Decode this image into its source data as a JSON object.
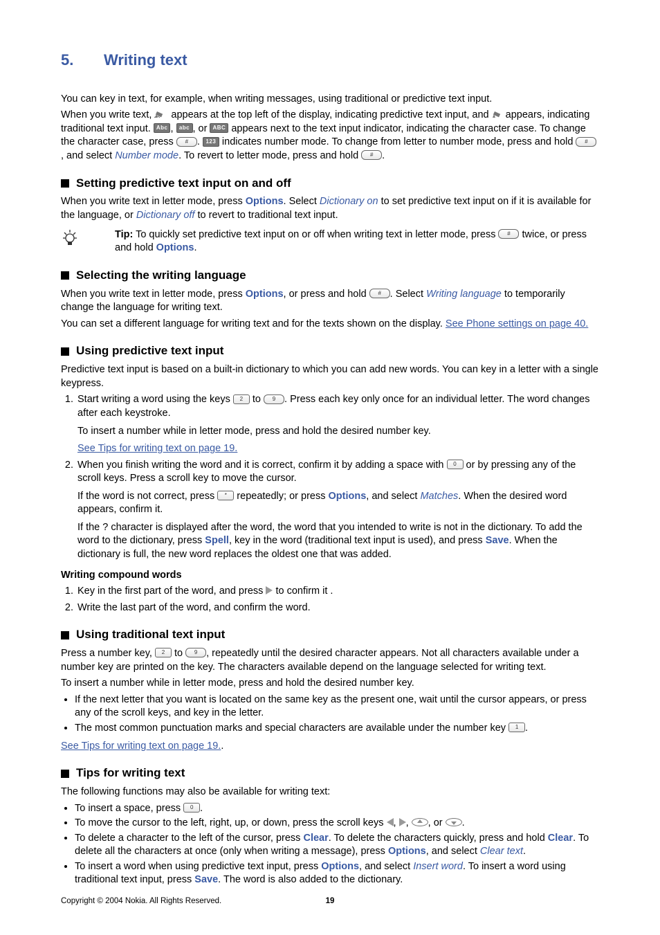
{
  "chapter": {
    "num": "5.",
    "title": "Writing text"
  },
  "intro": {
    "p1": "You can key in text, for example, when writing messages, using traditional or predictive text input.",
    "p2a": "When you write text, ",
    "p2b": " appears at the top left of the display, indicating predictive text input, and ",
    "p2c": " appears, indicating traditional text input. ",
    "p2d": ", ",
    "p2e": ", or",
    "p2f": " appears next to the text input indicator, indicating the character case. To change the character case, press ",
    "p2g": ". ",
    "p2h": " indicates number mode. To change from letter to number mode, press and hold ",
    "p2i": ", and select ",
    "number_mode": "Number mode",
    "p2j": ". To revert to letter mode, press and hold ",
    "p2k": "."
  },
  "ind": {
    "Abc": "Abc",
    "abc": "abc",
    "ABC": "ABC",
    "num": "123",
    "hash": "#",
    "star": "*",
    "two": "2",
    "nine": "9",
    "zero": "0",
    "one": "1"
  },
  "s1": {
    "heading": "Setting predictive text input on and off",
    "p1a": "When you write text in letter mode, press ",
    "options": "Options",
    "p1b": ". Select ",
    "dict_on": "Dictionary on",
    "p1c": " to set predictive text input on if it is available for the language, or ",
    "dict_off": "Dictionary off",
    "p1d": " to revert to traditional text input.",
    "tip_label": "Tip:",
    "tip_a": " To quickly set predictive text input on or off when writing text in letter mode, press ",
    "tip_b": " twice, or press and hold ",
    "tip_c": "."
  },
  "s2": {
    "heading": "Selecting the writing language",
    "p1a": "When you write text in letter mode, press ",
    "p1b": ", or press and hold ",
    "p1c": ". Select ",
    "writing_lang": "Writing language",
    "p1d": " to temporarily change the language for writing text.",
    "p2a": "You can set a different language for writing text and for the texts shown on the display. ",
    "link": "See Phone settings on page 40."
  },
  "s3": {
    "heading": "Using predictive text input",
    "p1": "Predictive text input is based on a built-in dictionary to which you can add new words. You can key in a letter with a single keypress.",
    "li1a": "Start writing a word using the keys ",
    "li1b": " to ",
    "li1c": ". Press each key only once for an individual letter. The word changes after each keystroke.",
    "li1_sub1": "To insert a number while in letter mode, press and hold the desired number key.",
    "li1_link": "See Tips for writing text on page 19.",
    "li2a": "When you finish writing the word and it is correct, confirm it by adding a space with ",
    "li2b": " or by pressing any of the scroll keys. Press a scroll key to move the cursor.",
    "li2_sub1a": "If the word is not correct, press ",
    "li2_sub1b": " repeatedly; or press ",
    "li2_sub1c": ", and select ",
    "matches": "Matches",
    "li2_sub1d": ". When the desired word appears, confirm it.",
    "li2_sub2a": "If the ? character is displayed after the word, the word that you intended to write is not in the dictionary. To add the word to the dictionary, press ",
    "spell": "Spell",
    "li2_sub2b": ", key in the word (traditional text input is used), and press ",
    "save": "Save",
    "li2_sub2c": ". When the dictionary is full, the new word replaces the oldest one that was added.",
    "compound_head": "Writing compound words",
    "c1a": "Key in the first part of the word, and press ",
    "c1b": " to confirm it .",
    "c2": "Write the last part of the word, and confirm the word."
  },
  "s4": {
    "heading": "Using traditional text input",
    "p1a": "Press a number key, ",
    "p1b": " to ",
    "p1c": ", repeatedly until the desired character appears. Not all characters available under a number key are printed on the key. The characters available depend on the language selected for writing text.",
    "p2": "To insert a number while in letter mode, press and hold the desired number key.",
    "b1": "If the next letter that you want is located on the same key as the present one, wait until the cursor appears, or press any of the scroll keys, and key in the letter.",
    "b2a": "The most common punctuation marks and special characters are available under the number key ",
    "b2b": ".",
    "link": "See Tips for writing text on page 19.",
    "linkdot": "."
  },
  "s5": {
    "heading": "Tips for writing text",
    "p1": "The following functions may also be available for writing text:",
    "b1a": "To insert a space, press ",
    "b1b": ".",
    "b2a": "To move the cursor to the left, right, up, or down, press the scroll keys ",
    "b2b": ", ",
    "b2c": ", ",
    "b2d": ", or ",
    "b2e": ".",
    "b3a": "To delete a character to the left of the cursor, press ",
    "clear": "Clear",
    "b3b": ". To delete the characters quickly, press and hold ",
    "b3c": ". To delete all the characters at once (only when writing a message), press ",
    "options": "Options",
    "b3d": ", and select ",
    "clear_text": "Clear text",
    "b3e": ".",
    "b4a": "To insert a word when using predictive text input, press ",
    "b4b": ", and select ",
    "insert_word": "Insert word",
    "b4c": ". To insert a word using traditional text input, press ",
    "save": "Save",
    "b4d": ". The word is also added to the dictionary."
  },
  "footer": {
    "copy": "Copyright © 2004 Nokia. All Rights Reserved.",
    "page": "19"
  }
}
